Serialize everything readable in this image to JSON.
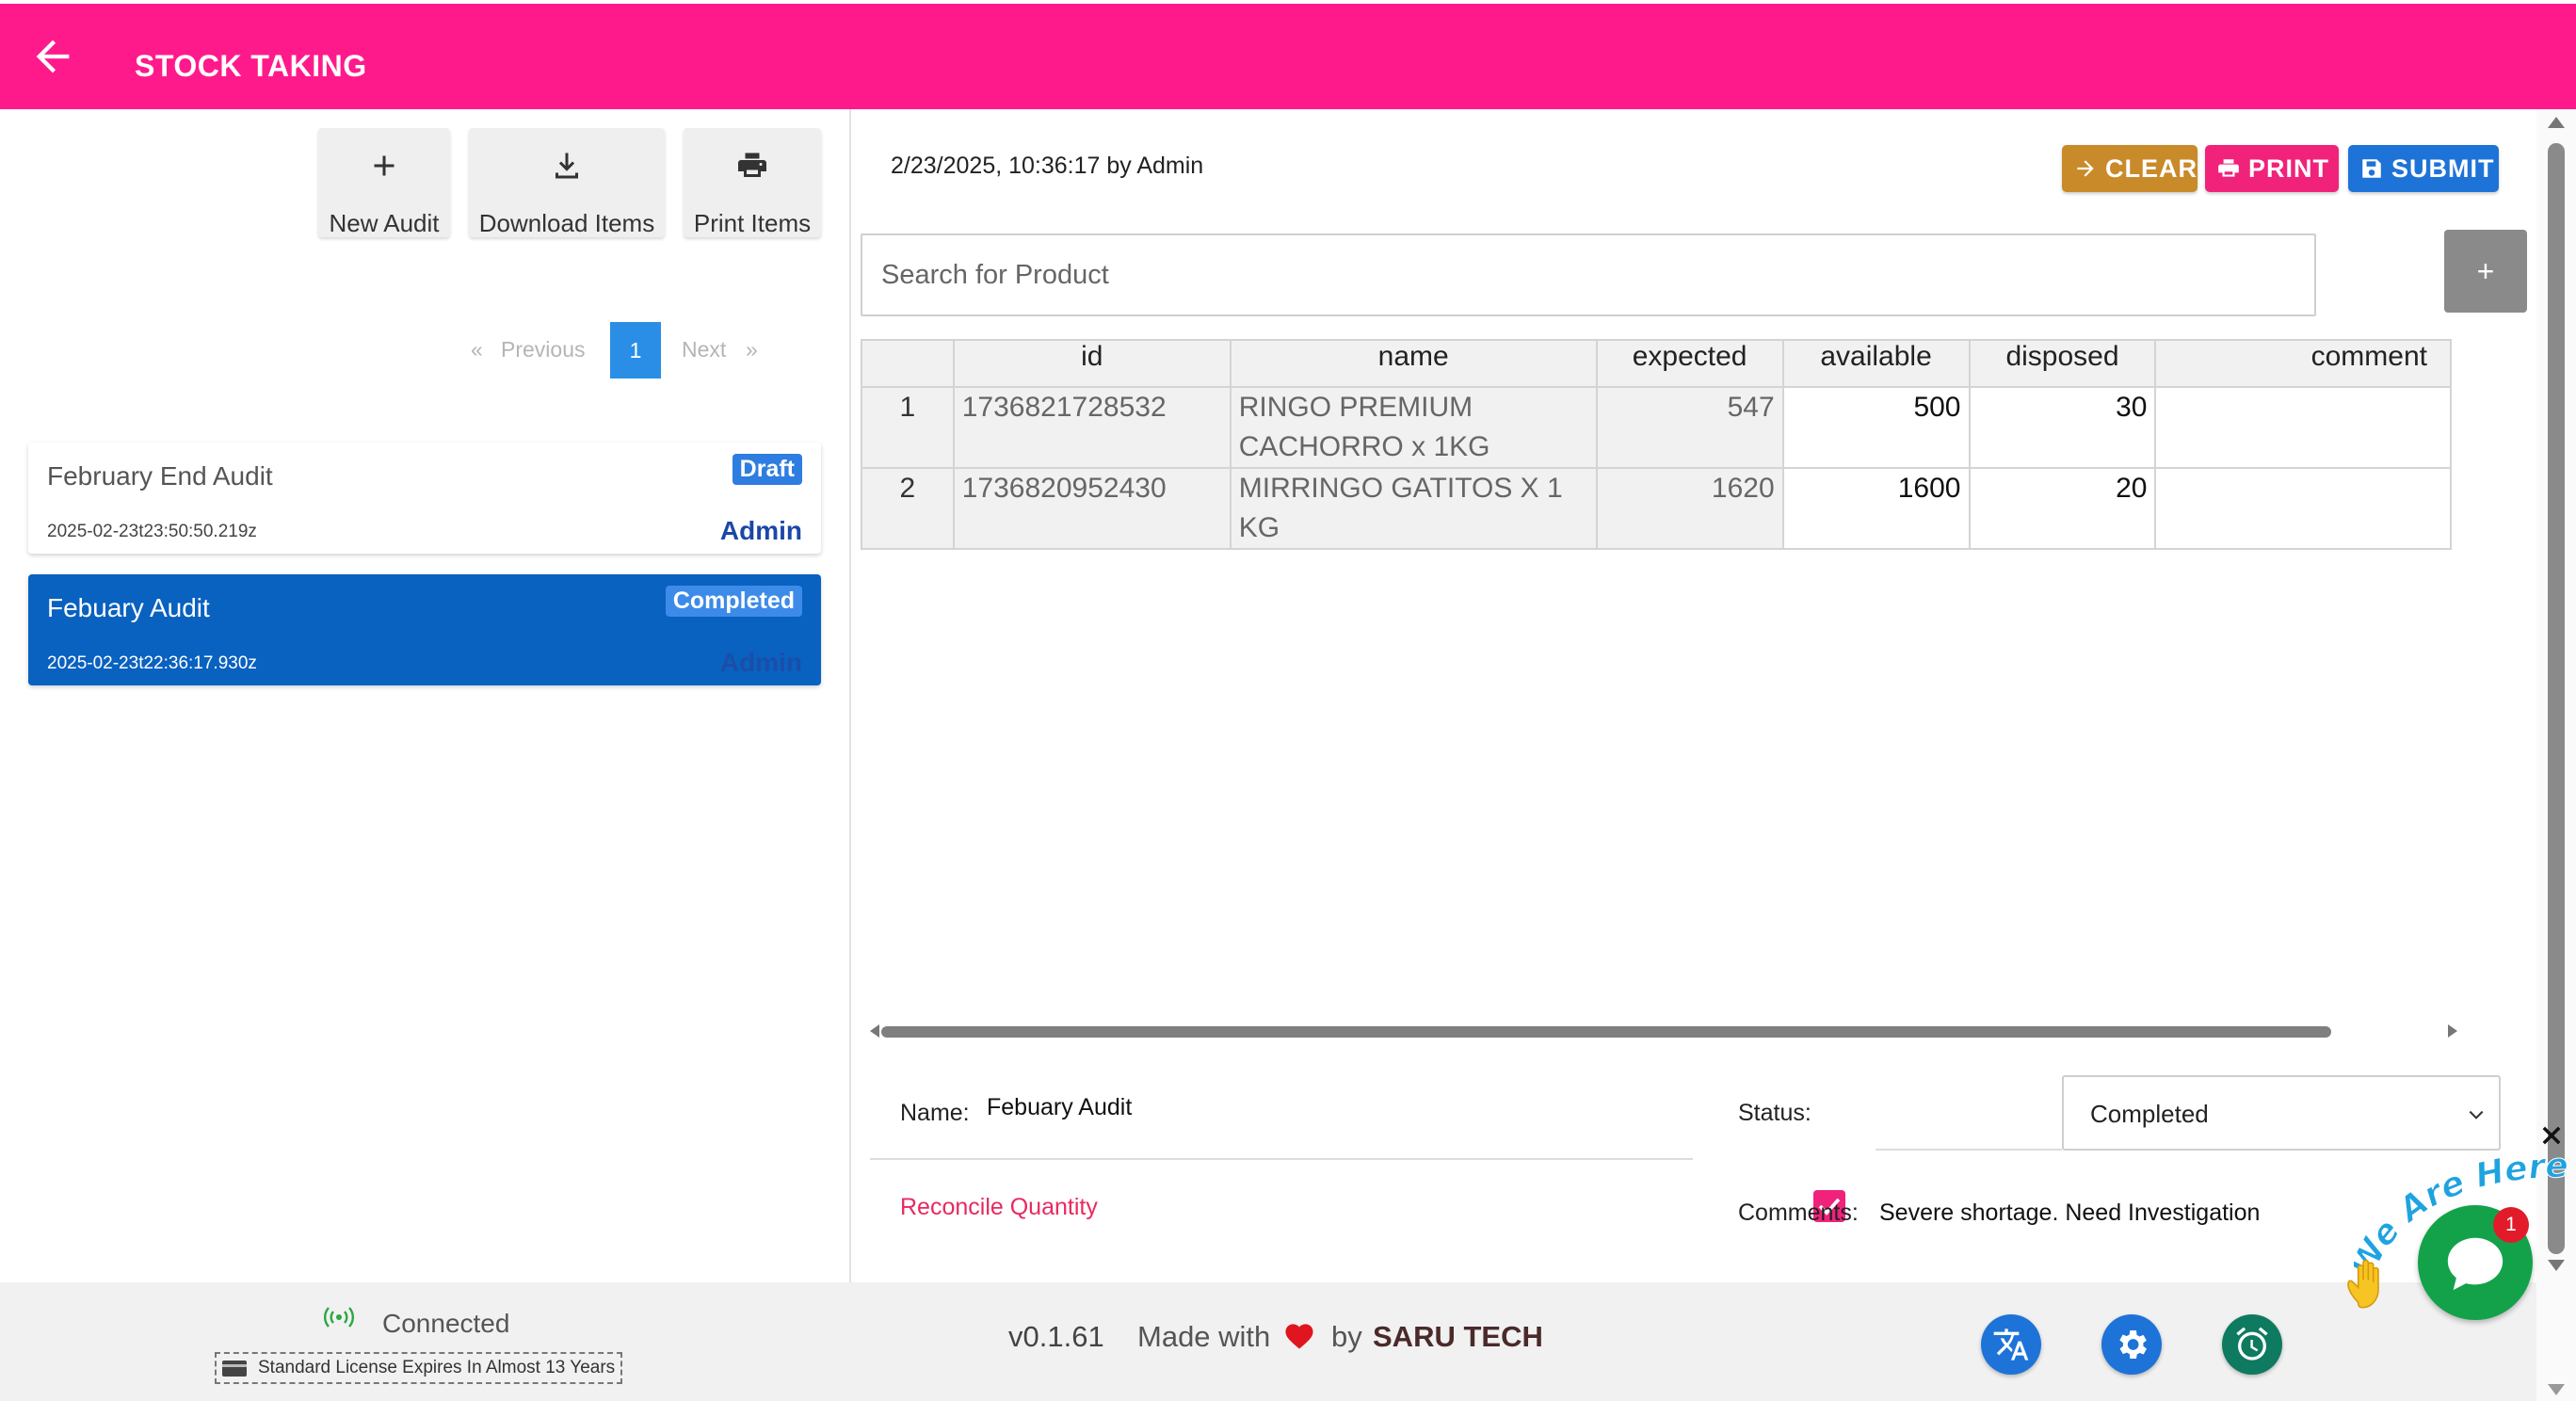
{
  "header": {
    "title": "STOCK TAKING"
  },
  "toolbar": {
    "new_audit": "New Audit",
    "download_items": "Download Items",
    "print_items": "Print Items"
  },
  "pagination": {
    "previous": "Previous",
    "current": "1",
    "next": "Next",
    "prev_arrow": "«",
    "next_arrow": "»"
  },
  "audits": [
    {
      "name": "February End Audit",
      "date": "2025-02-23t23:50:50.219z",
      "user": "Admin",
      "status": "Draft"
    },
    {
      "name": "Febuary Audit",
      "date": "2025-02-23t22:36:17.930z",
      "user": "Admin",
      "status": "Completed"
    }
  ],
  "detail": {
    "meta": "2/23/2025, 10:36:17 by Admin",
    "clear_label": "CLEAR",
    "print_label": "PRINT",
    "submit_label": "SUBMIT",
    "search_placeholder": "Search for Product",
    "add_label": "+",
    "columns": [
      "",
      "id",
      "name",
      "expected",
      "available",
      "disposed",
      "comment"
    ],
    "rows": [
      {
        "idx": "1",
        "id": "1736821728532",
        "name": "RINGO PREMIUM CACHORRO x 1KG",
        "expected": "547",
        "available": "500",
        "disposed": "30",
        "comment": ""
      },
      {
        "idx": "2",
        "id": "1736820952430",
        "name": "MIRRINGO GATITOS X 1 KG",
        "expected": "1620",
        "available": "1600",
        "disposed": "20",
        "comment": ""
      }
    ],
    "form": {
      "name_label": "Name:",
      "name_value": "Febuary Audit",
      "status_label": "Status:",
      "status_value": "Completed",
      "reconcile_label": "Reconcile Quantity",
      "reconcile_checked": true,
      "comments_label": "Comments:",
      "comments_value": "Severe shortage. Need Investigation"
    }
  },
  "footer": {
    "connection": "Connected",
    "license": "Standard License Expires In Almost 13 Years",
    "version": "v0.1.61",
    "made_with": "Made with",
    "by": "by",
    "brand": "SARU TECH"
  },
  "chat": {
    "tagline": "We Are Here!",
    "badge": "1"
  },
  "colors": {
    "header": "#ff1a8c",
    "clear": "#c98a2a",
    "print": "#f0227a",
    "submit": "#1e73d8",
    "selected_card": "#0961c0",
    "chat": "#13a24a"
  }
}
